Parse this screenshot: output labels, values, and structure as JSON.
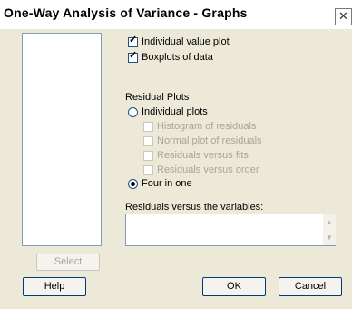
{
  "dialog": {
    "title": "One-Way Analysis of Variance - Graphs",
    "close_glyph": "✕"
  },
  "graphs": {
    "individual_value_plot": {
      "label": "Individual value plot",
      "checked": true
    },
    "boxplots_of_data": {
      "label": "Boxplots of data",
      "checked": true
    }
  },
  "residual_plots": {
    "heading": "Residual Plots",
    "individual_plots_label": "Individual plots",
    "histogram_label": "Histogram of residuals",
    "normal_plot_label": "Normal plot of residuals",
    "versus_fits_label": "Residuals versus fits",
    "versus_order_label": "Residuals versus order",
    "four_in_one_label": "Four in one",
    "selected": "Four in one"
  },
  "residuals_vs_variables": {
    "label": "Residuals versus the variables:",
    "value": ""
  },
  "buttons": {
    "select": "Select",
    "help": "Help",
    "ok": "OK",
    "cancel": "Cancel"
  },
  "icons": {
    "scroll_up": "▲",
    "scroll_down": "▼",
    "check": "✓"
  }
}
